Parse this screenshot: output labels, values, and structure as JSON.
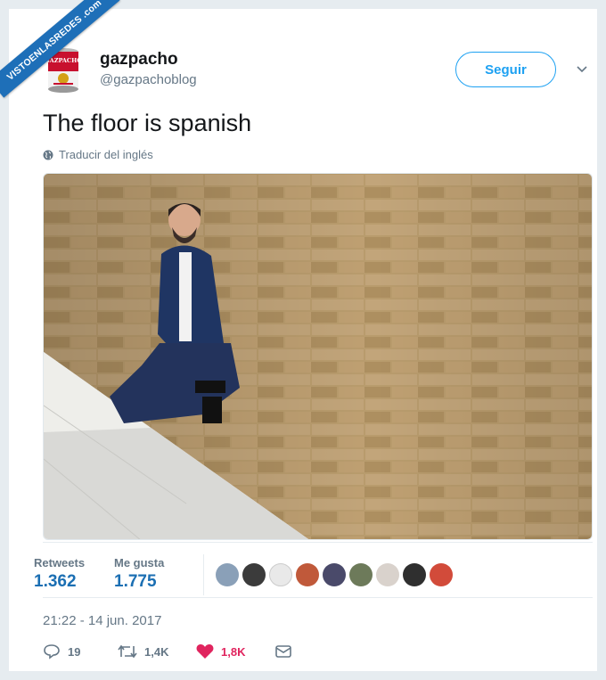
{
  "watermark": "VISTOENLASREDES .com",
  "account": {
    "name": "gazpacho",
    "handle": "@gazpachoblog",
    "avatar_logo_text": "GAZPACHO",
    "follow_label": "Seguir"
  },
  "tweet": {
    "text": "The floor is spanish",
    "translate_label": "Traducir del inglés"
  },
  "stats": {
    "retweets_label": "Retweets",
    "retweets_value": "1.362",
    "likes_label": "Me gusta",
    "likes_value": "1.775"
  },
  "timestamp": "21:22 - 14 jun. 2017",
  "actions": {
    "reply_count": "19",
    "retweet_count": "1,4K",
    "like_count": "1,8K"
  },
  "colors": {
    "accent": "#1da1f2",
    "stat_blue": "#1b6fb3",
    "like_red": "#e0245e",
    "watermark_blue": "#1e6fb8"
  }
}
